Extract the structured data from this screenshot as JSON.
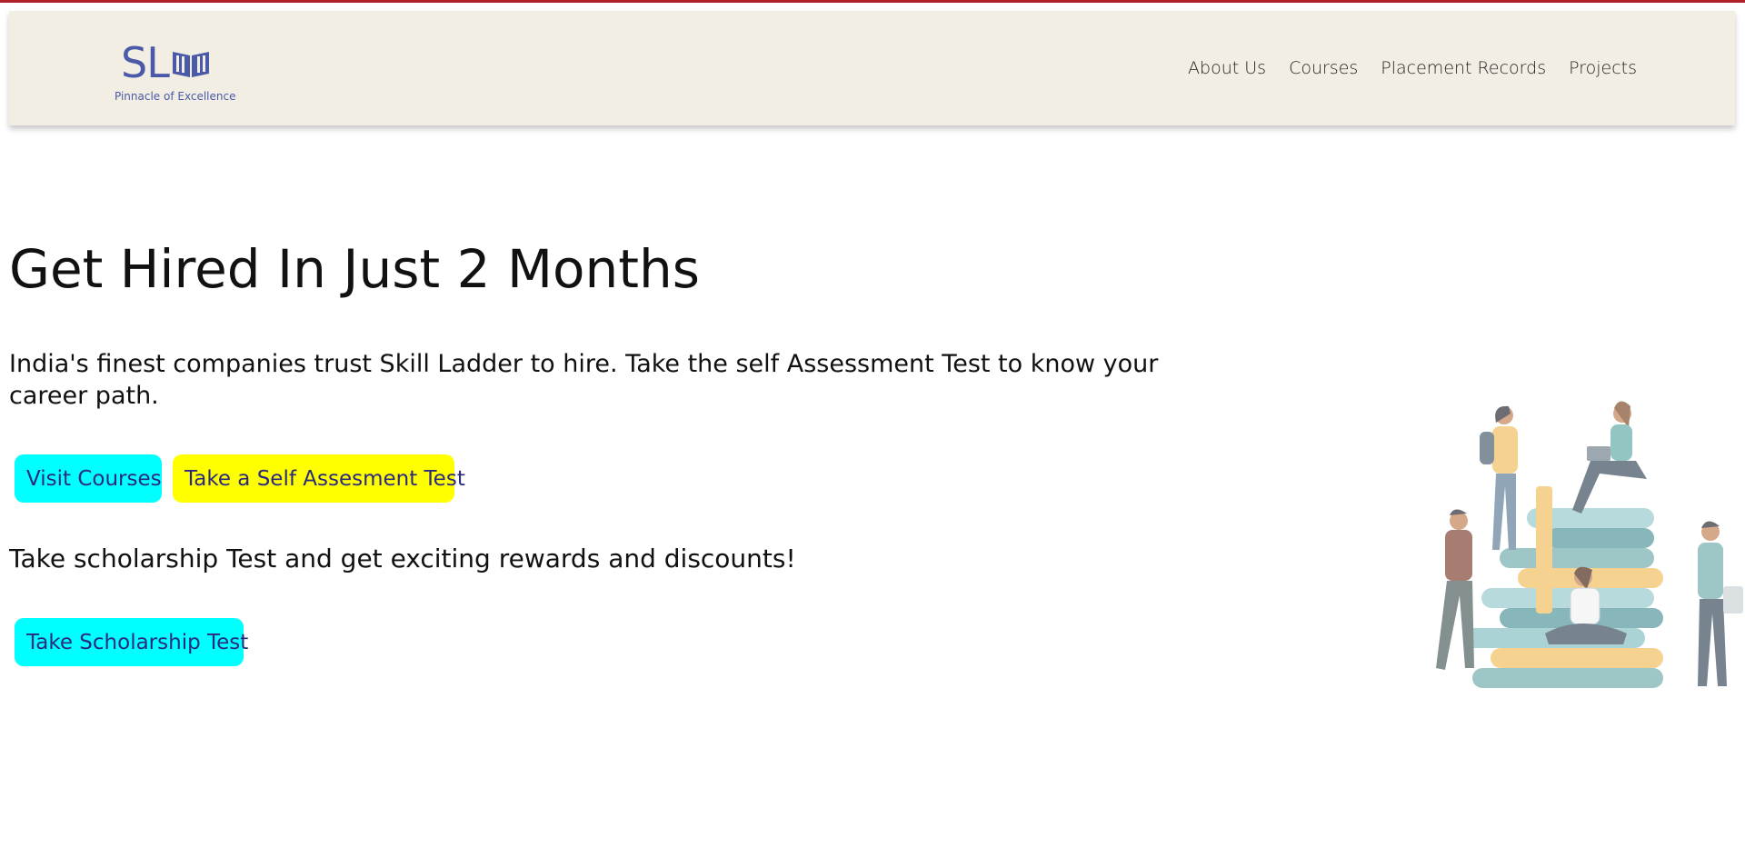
{
  "brand": {
    "initials": "SL",
    "tagline": "Pinnacle of Excellence",
    "color": "#4a5aa8"
  },
  "nav": {
    "items": [
      "About Us",
      "Courses",
      "Placement Records",
      "Projects"
    ]
  },
  "hero": {
    "title": "Get Hired In Just 2 Months",
    "subtitle": "India's finest companies trust Skill Ladder to hire. Take the self Assessment Test to know your career path.",
    "buttons": {
      "courses": "Visit Courses",
      "self_test": "Take a Self Assesment Test"
    },
    "scholarship_text": "Take scholarship Test and get exciting rewards and discounts!",
    "scholarship_button": "Take Scholarship Test"
  },
  "colors": {
    "accent_cyan": "#00ffff",
    "accent_yellow": "#ffff00",
    "navbar_bg": "#f2eee4",
    "top_border": "#b0202a"
  },
  "illustration": {
    "icon": "students-on-books-illustration"
  }
}
